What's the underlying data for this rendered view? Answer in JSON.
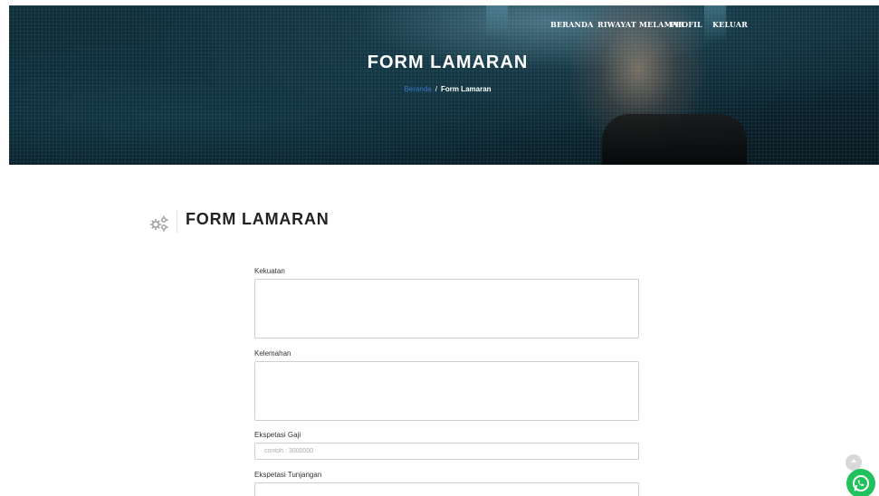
{
  "nav": {
    "items": [
      "BERANDA",
      "RIWAYAT MELAMAR",
      "PROFIL",
      "KELUAR"
    ]
  },
  "hero": {
    "title": "FORM LAMARAN",
    "breadcrumb_home": "Beranda",
    "breadcrumb_separator": "/",
    "breadcrumb_current": "Form Lamaran"
  },
  "section": {
    "icon": "gears-icon",
    "title": "FORM LAMARAN"
  },
  "form": {
    "strengths_label": "Kekuatan",
    "strengths_value": "",
    "weaknesses_label": "Kelemahan",
    "weaknesses_value": "",
    "salary_label": "Ekspetasi Gaji",
    "salary_placeholder": "contoh : 3000000",
    "benefits_label": "Ekspetasi Tunjangan",
    "benefits_value": ""
  },
  "floating": {
    "scroll_top_icon": "chevron-up-icon",
    "whatsapp_icon": "whatsapp-icon"
  },
  "colors": {
    "hero_dark": "#0a2530",
    "breadcrumb_link": "#3c74c6",
    "whatsapp_green": "#21c25e"
  }
}
